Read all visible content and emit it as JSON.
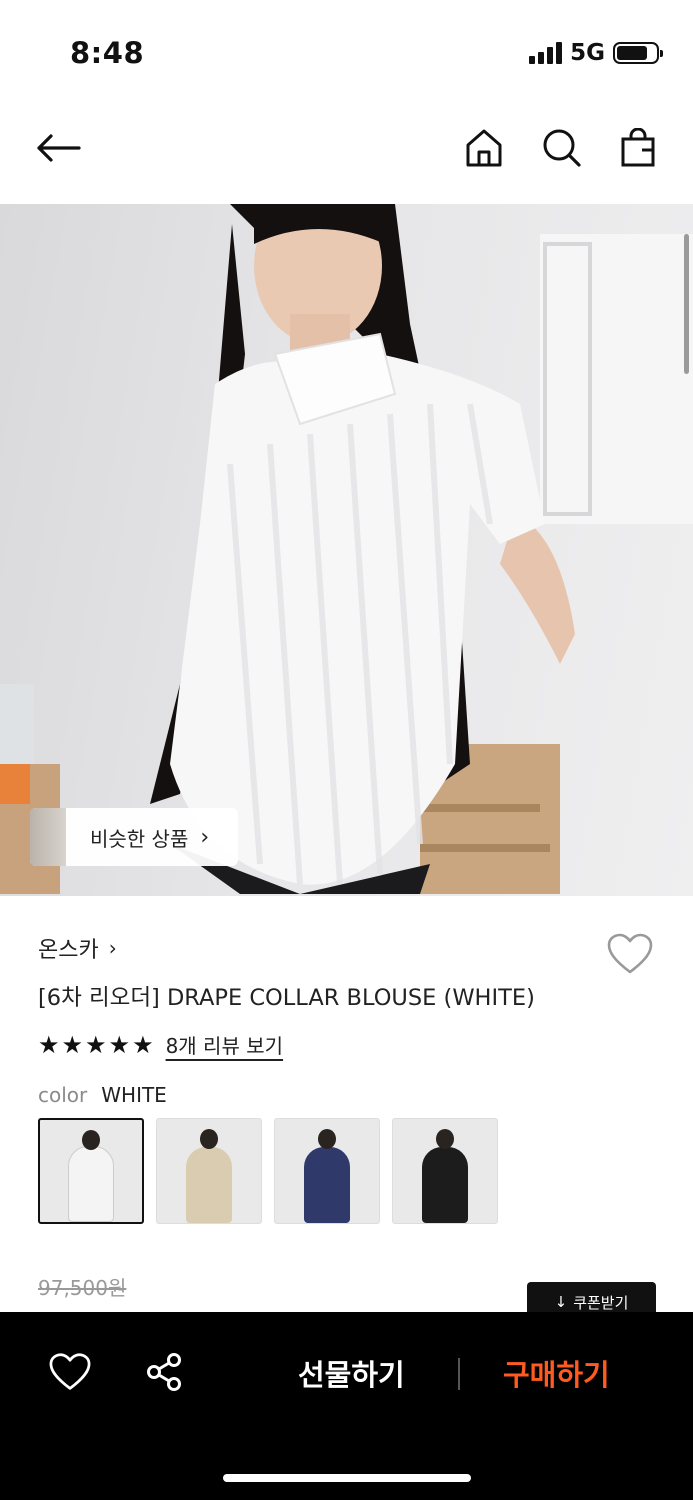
{
  "status_bar": {
    "time": "8:48",
    "network": "5G",
    "battery_level": 0.8
  },
  "nav": {
    "icons": [
      "back-arrow-icon",
      "home-icon",
      "search-icon",
      "shopping-bag-icon"
    ]
  },
  "hero": {
    "similar_products_label": "비슷한 상품"
  },
  "product": {
    "brand": "온스카",
    "title": "[6차 리오더] DRAPE COLLAR BLOUSE (WHITE)",
    "rating_stars": 5,
    "review_link": "8개 리뷰 보기",
    "color_label": "color",
    "color_value": "WHITE",
    "swatches": [
      {
        "name": "white",
        "color": "#f4f4f4",
        "selected": true
      },
      {
        "name": "beige-check",
        "color": "#d9ccb0",
        "selected": false
      },
      {
        "name": "navy-check",
        "color": "#2f3a6b",
        "selected": false
      },
      {
        "name": "black",
        "color": "#1c1c1c",
        "selected": false
      }
    ],
    "original_price": "97,500원",
    "coupon_label": "쿠폰받기"
  },
  "bottom_bar": {
    "gift_label": "선물하기",
    "buy_label": "구매하기",
    "buy_color": "#ff5a1f"
  }
}
